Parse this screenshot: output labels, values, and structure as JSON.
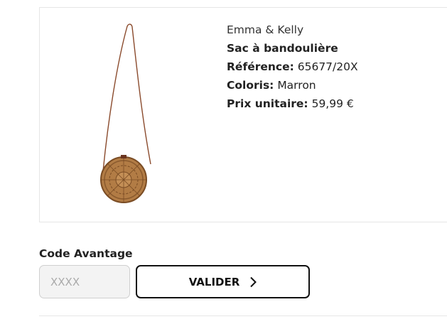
{
  "product": {
    "brand": "Emma & Kelly",
    "name": "Sac à bandoulière",
    "reference_label": "Référence:",
    "reference_value": "65677/20X",
    "color_label": "Coloris:",
    "color_value": "Marron",
    "price_label": "Prix unitaire:",
    "price_value": "59,99 €",
    "image_icon": "round-rattan-crossbody-bag"
  },
  "promo": {
    "label": "Code Avantage",
    "placeholder": "XXXX",
    "button_label": "VALIDER",
    "button_icon": "chevron-right-icon"
  },
  "colors": {
    "strap": "#8a4a2c",
    "rattan": "#b27c45",
    "button_border": "#111111",
    "input_bg": "#f3f3f3"
  }
}
